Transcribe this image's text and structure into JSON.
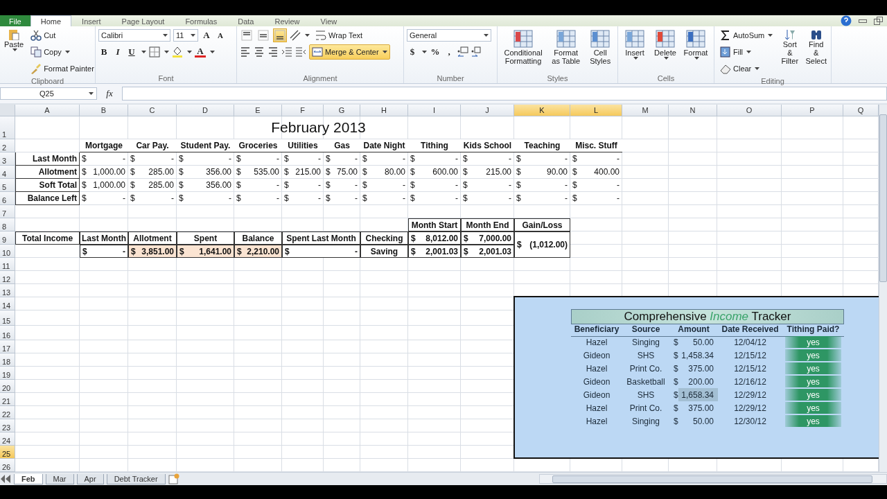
{
  "ribbon": {
    "tabs": [
      {
        "label": "File",
        "kind": "file",
        "selected": false
      },
      {
        "label": "Home",
        "kind": "tab",
        "selected": true
      },
      {
        "label": "Insert",
        "kind": "tab",
        "selected": false
      },
      {
        "label": "Page Layout",
        "kind": "tab",
        "selected": false
      },
      {
        "label": "Formulas",
        "kind": "tab",
        "selected": false
      },
      {
        "label": "Data",
        "kind": "tab",
        "selected": false
      },
      {
        "label": "Review",
        "kind": "tab",
        "selected": false
      },
      {
        "label": "View",
        "kind": "tab",
        "selected": false
      }
    ],
    "clipboard": {
      "label": "Clipboard",
      "paste": "Paste",
      "cut": "Cut",
      "copy": "Copy",
      "format_painter": "Format Painter"
    },
    "font": {
      "label": "Font",
      "family": "Calibri",
      "size": "11",
      "grow": "A",
      "shrink": "A",
      "bold": "B",
      "italic": "I",
      "underline": "U",
      "font_color": "A"
    },
    "alignment": {
      "label": "Alignment",
      "vertical": [
        {
          "selected": false
        },
        {
          "selected": false
        },
        {
          "selected": true
        }
      ],
      "wrap_text": "Wrap Text",
      "merge_center": {
        "label": "Merge & Center",
        "selected": true
      }
    },
    "number": {
      "label": "Number",
      "format": "General",
      "currency": "$",
      "percent": "%",
      "comma": ","
    },
    "styles": {
      "label": "Styles",
      "buttons": [
        "Conditional Formatting",
        "Format as Table",
        "Cell Styles"
      ]
    },
    "cells": {
      "label": "Cells",
      "buttons": [
        "Insert",
        "Delete",
        "Format"
      ]
    },
    "editing": {
      "label": "Editing",
      "autosum": "AutoSum",
      "fill": "Fill",
      "clear": "Clear",
      "sort_filter": "Sort & Filter",
      "find_select": "Find & Select"
    }
  },
  "formula_bar": {
    "name_box": "Q25",
    "function_label": "fx"
  },
  "sheet": {
    "columns": [
      {
        "letter": "A",
        "selected": false
      },
      {
        "letter": "B",
        "selected": false
      },
      {
        "letter": "C",
        "selected": false
      },
      {
        "letter": "D",
        "selected": false
      },
      {
        "letter": "E",
        "selected": false
      },
      {
        "letter": "F",
        "selected": false
      },
      {
        "letter": "G",
        "selected": false
      },
      {
        "letter": "H",
        "selected": false
      },
      {
        "letter": "I",
        "selected": false
      },
      {
        "letter": "J",
        "selected": false
      },
      {
        "letter": "K",
        "selected": true
      },
      {
        "letter": "L",
        "selected": true
      },
      {
        "letter": "M",
        "selected": false
      },
      {
        "letter": "N",
        "selected": false
      },
      {
        "letter": "O",
        "selected": false
      },
      {
        "letter": "P",
        "selected": false
      },
      {
        "letter": "Q",
        "selected": false
      }
    ],
    "row_numbers": [
      {
        "label": "1",
        "selected": false
      },
      {
        "label": "2",
        "selected": false
      },
      {
        "label": "3",
        "selected": false
      },
      {
        "label": "4",
        "selected": false
      },
      {
        "label": "5",
        "selected": false
      },
      {
        "label": "6",
        "selected": false
      },
      {
        "label": "7",
        "selected": false
      },
      {
        "label": "8",
        "selected": false
      },
      {
        "label": "9",
        "selected": false
      },
      {
        "label": "10",
        "selected": false
      },
      {
        "label": "11",
        "selected": false
      },
      {
        "label": "12",
        "selected": false
      },
      {
        "label": "13",
        "selected": false
      },
      {
        "label": "14",
        "selected": false
      },
      {
        "label": "15",
        "selected": false
      },
      {
        "label": "16",
        "selected": false
      },
      {
        "label": "17",
        "selected": false
      },
      {
        "label": "18",
        "selected": false
      },
      {
        "label": "19",
        "selected": false
      },
      {
        "label": "20",
        "selected": false
      },
      {
        "label": "21",
        "selected": false
      },
      {
        "label": "22",
        "selected": false
      },
      {
        "label": "23",
        "selected": false
      },
      {
        "label": "24",
        "selected": false
      },
      {
        "label": "25",
        "selected": true
      },
      {
        "label": "26",
        "selected": false
      }
    ],
    "title": "February 2013",
    "budget": {
      "columns": [
        "Mortgage",
        "Car Pay.",
        "Student Pay.",
        "Groceries",
        "Utilities",
        "Gas",
        "Date Night",
        "Tithing",
        "Kids School",
        "Teaching",
        "Misc. Stuff"
      ],
      "rows": [
        {
          "label": "Last Month",
          "values": [
            {
              "currency": "$",
              "amount": "-"
            },
            {
              "currency": "$",
              "amount": "-"
            },
            {
              "currency": "$",
              "amount": "-"
            },
            {
              "currency": "$",
              "amount": "-"
            },
            {
              "currency": "$",
              "amount": "-"
            },
            {
              "currency": "$",
              "amount": "-"
            },
            {
              "currency": "$",
              "amount": "-"
            },
            {
              "currency": "$",
              "amount": "-"
            },
            {
              "currency": "$",
              "amount": "-"
            },
            {
              "currency": "$",
              "amount": "-"
            },
            {
              "currency": "$",
              "amount": "-"
            }
          ]
        },
        {
          "label": "Allotment",
          "values": [
            {
              "currency": "$",
              "amount": "1,000.00"
            },
            {
              "currency": "$",
              "amount": "285.00"
            },
            {
              "currency": "$",
              "amount": "356.00"
            },
            {
              "currency": "$",
              "amount": "535.00"
            },
            {
              "currency": "$",
              "amount": "215.00"
            },
            {
              "currency": "$",
              "amount": "75.00"
            },
            {
              "currency": "$",
              "amount": "80.00"
            },
            {
              "currency": "$",
              "amount": "600.00"
            },
            {
              "currency": "$",
              "amount": "215.00"
            },
            {
              "currency": "$",
              "amount": "90.00"
            },
            {
              "currency": "$",
              "amount": "400.00"
            }
          ]
        },
        {
          "label": "Soft Total",
          "values": [
            {
              "currency": "$",
              "amount": "1,000.00"
            },
            {
              "currency": "$",
              "amount": "285.00"
            },
            {
              "currency": "$",
              "amount": "356.00"
            },
            {
              "currency": "$",
              "amount": "-"
            },
            {
              "currency": "$",
              "amount": "-"
            },
            {
              "currency": "$",
              "amount": "-"
            },
            {
              "currency": "$",
              "amount": "-"
            },
            {
              "currency": "$",
              "amount": "-"
            },
            {
              "currency": "$",
              "amount": "-"
            },
            {
              "currency": "$",
              "amount": "-"
            },
            {
              "currency": "$",
              "amount": "-"
            }
          ]
        },
        {
          "label": "Balance Left",
          "values": [
            {
              "currency": "$",
              "amount": "-"
            },
            {
              "currency": "$",
              "amount": "-"
            },
            {
              "currency": "$",
              "amount": "-"
            },
            {
              "currency": "$",
              "amount": "-"
            },
            {
              "currency": "$",
              "amount": "-"
            },
            {
              "currency": "$",
              "amount": "-"
            },
            {
              "currency": "$",
              "amount": "-"
            },
            {
              "currency": "$",
              "amount": "-"
            },
            {
              "currency": "$",
              "amount": "-"
            },
            {
              "currency": "$",
              "amount": "-"
            },
            {
              "currency": "$",
              "amount": "-"
            }
          ]
        }
      ]
    },
    "summary": {
      "rows": [
        [
          "",
          "",
          "",
          "",
          "",
          "",
          "",
          "",
          {
            "kind": "heading",
            "text": "Month Start"
          },
          {
            "kind": "heading",
            "text": "Month End"
          },
          {
            "kind": "heading",
            "text": "Gain/Loss"
          }
        ],
        [
          {
            "kind": "heading",
            "text": "Total Income"
          },
          {
            "kind": "heading",
            "text": "Last Month"
          },
          {
            "kind": "heading",
            "text": "Allotment"
          },
          {
            "kind": "heading",
            "text": "Spent"
          },
          {
            "kind": "heading",
            "text": "Balance"
          },
          {
            "kind": "heading",
            "text": "Spent Last Month",
            "colspan": 2
          },
          {
            "kind": "heading",
            "text": "Checking"
          },
          {
            "kind": "money",
            "currency": "$",
            "amount": "8,012.00"
          },
          {
            "kind": "money",
            "currency": "$",
            "amount": "7,000.00"
          },
          {
            "kind": "money",
            "currency": "$",
            "amount": "(1,012.00)",
            "rowspan": 2
          }
        ],
        [
          "",
          {
            "kind": "money",
            "currency": "$",
            "amount": "-"
          },
          {
            "kind": "total",
            "currency": "$",
            "amount": "3,851.00"
          },
          {
            "kind": "total",
            "currency": "$",
            "amount": "1,641.00"
          },
          {
            "kind": "total",
            "currency": "$",
            "amount": "2,210.00"
          },
          {
            "kind": "money",
            "currency": "$",
            "amount": "-",
            "colspan": 2
          },
          {
            "kind": "heading",
            "text": "Saving"
          },
          {
            "kind": "money",
            "currency": "$",
            "amount": "2,001.03"
          },
          {
            "kind": "money",
            "currency": "$",
            "amount": "2,001.03"
          }
        ]
      ]
    },
    "tracker": {
      "title": "Comprehensive *Income* Tracker",
      "columns": [
        "Beneficiary",
        "Source",
        "Amount",
        "Date Received",
        "Tithing Paid?"
      ],
      "rows": [
        {
          "beneficiary": "Hazel",
          "source": "Singing",
          "currency": "$",
          "amount": "50.00",
          "selected": false,
          "date": "12/04/12",
          "tithing_paid": "yes"
        },
        {
          "beneficiary": "Gideon",
          "source": "SHS",
          "currency": "$",
          "amount": "1,458.34",
          "selected": false,
          "date": "12/15/12",
          "tithing_paid": "yes"
        },
        {
          "beneficiary": "Hazel",
          "source": "Print Co.",
          "currency": "$",
          "amount": "375.00",
          "selected": false,
          "date": "12/15/12",
          "tithing_paid": "yes"
        },
        {
          "beneficiary": "Gideon",
          "source": "Basketball",
          "currency": "$",
          "amount": "200.00",
          "selected": false,
          "date": "12/16/12",
          "tithing_paid": "yes"
        },
        {
          "beneficiary": "Gideon",
          "source": "SHS",
          "currency": "$",
          "amount": "1,658.34",
          "selected": true,
          "date": "12/29/12",
          "tithing_paid": "yes"
        },
        {
          "beneficiary": "Hazel",
          "source": "Print Co.",
          "currency": "$",
          "amount": "375.00",
          "selected": false,
          "date": "12/29/12",
          "tithing_paid": "yes"
        },
        {
          "beneficiary": "Hazel",
          "source": "Singing",
          "currency": "$",
          "amount": "50.00",
          "selected": false,
          "date": "12/30/12",
          "tithing_paid": "yes"
        }
      ]
    }
  },
  "sheet_tabs": [
    {
      "label": "Feb",
      "selected": true
    },
    {
      "label": "Mar",
      "selected": false
    },
    {
      "label": "Apr",
      "selected": false
    },
    {
      "label": "Debt Tracker",
      "selected": false
    }
  ]
}
